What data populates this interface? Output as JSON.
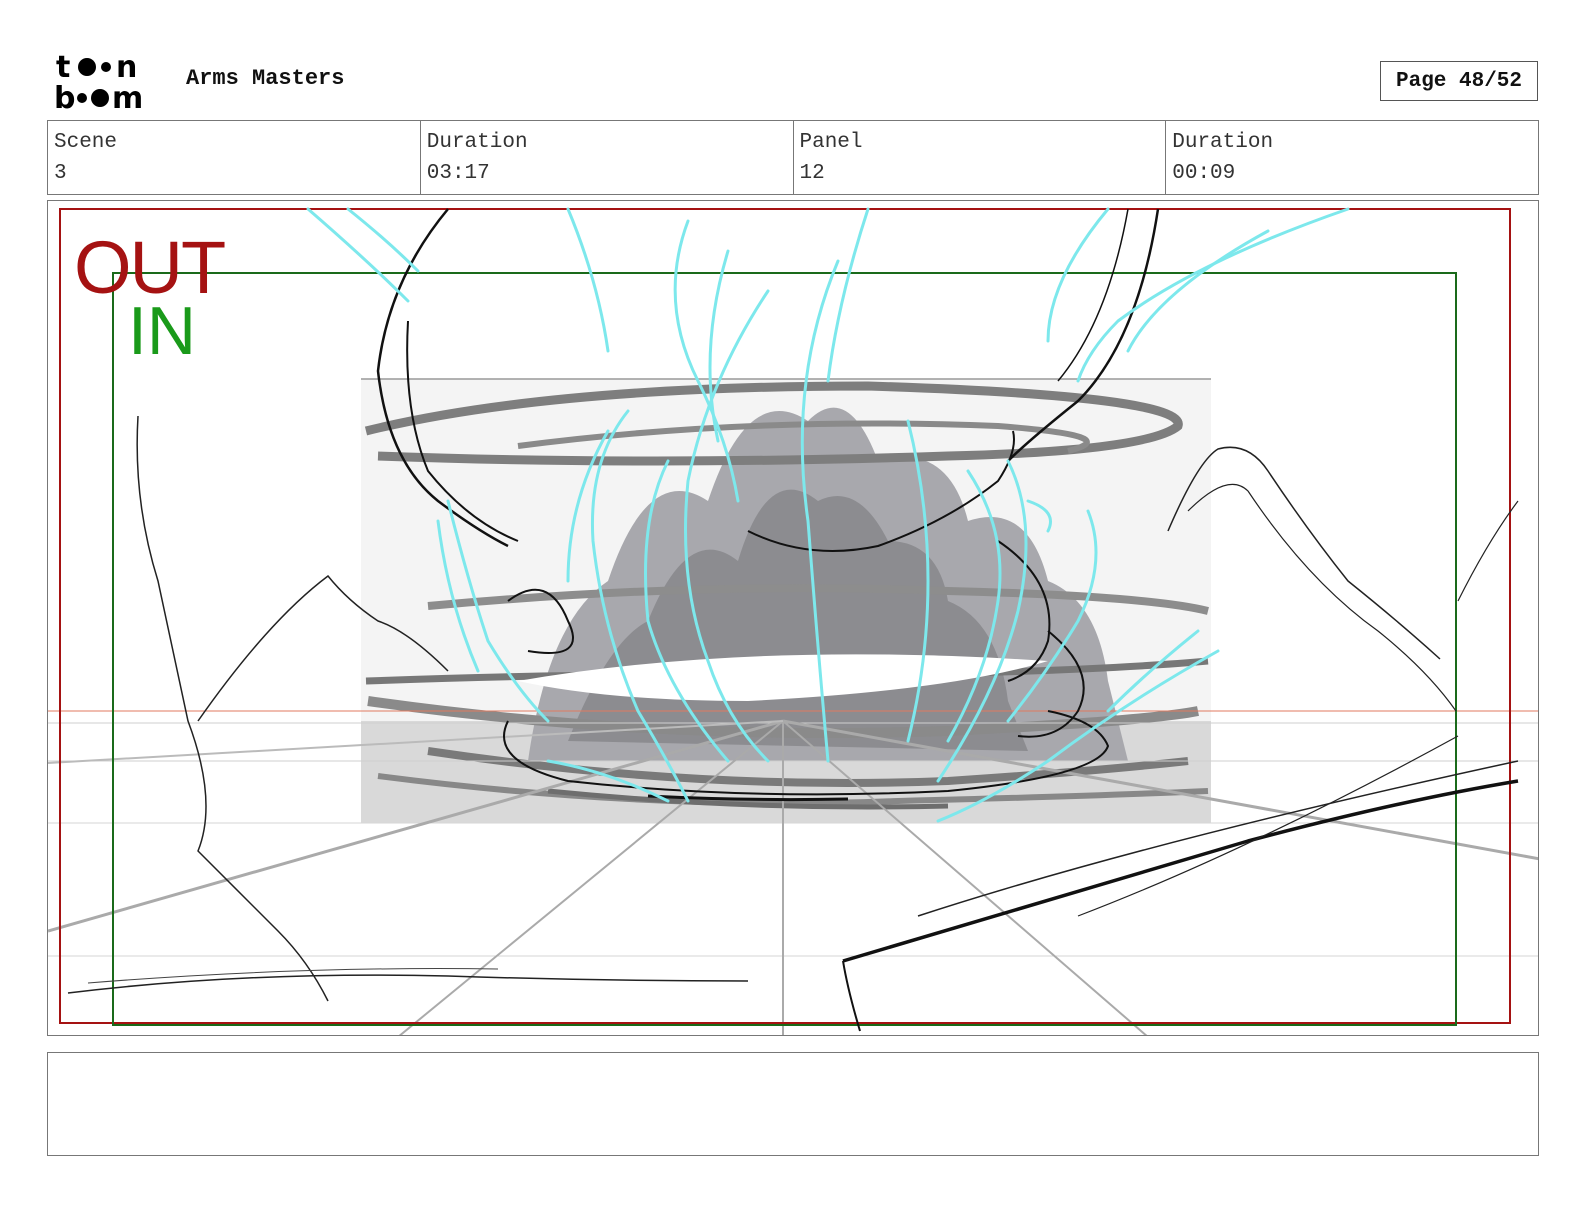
{
  "header": {
    "logo_text": [
      "t●●n",
      "b●●m"
    ],
    "title": "Arms Masters",
    "page_label": "Page 48/52"
  },
  "info": {
    "scene_label": "Scene",
    "scene_value": "3",
    "scene_duration_label": "Duration",
    "scene_duration_value": "03:17",
    "panel_label": "Panel",
    "panel_value": "12",
    "panel_duration_label": "Duration",
    "panel_duration_value": "00:09"
  },
  "frame": {
    "out_label": "OUT",
    "in_label": "IN",
    "out_color": "#a51212",
    "in_color": "#1a9a1a"
  },
  "notes": {
    "text": ""
  }
}
